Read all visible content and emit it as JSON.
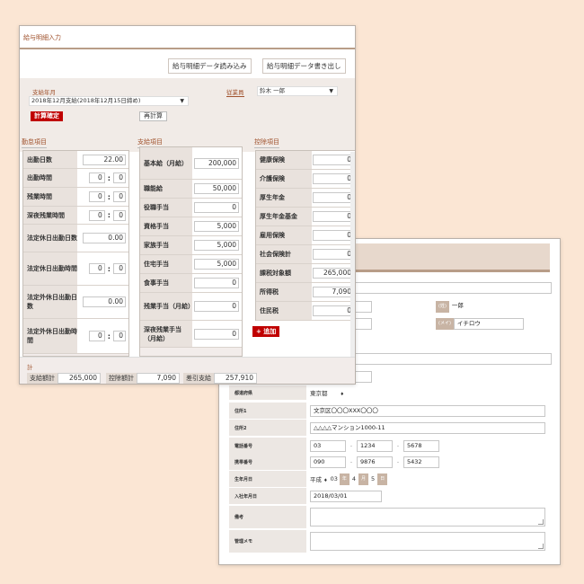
{
  "back": {
    "rows": {
      "r1_badge1": "(姓)",
      "r1_value": "一郎",
      "r2_badge": "(メイ)",
      "r2_value": "イチロウ",
      "prefecture": {
        "label": "都道府県",
        "value": "東京都"
      },
      "address1": {
        "label": "住所1",
        "value": "文京区〇〇〇XXX〇〇〇"
      },
      "address2": {
        "label": "住所2",
        "value": "△△△△マンション1000-11"
      },
      "phone": {
        "label": "電話番号",
        "p1": "03",
        "p2": "1234",
        "p3": "5678"
      },
      "mobile": {
        "label": "携帯番号",
        "p1": "090",
        "p2": "9876",
        "p3": "5432"
      },
      "birthday": {
        "label": "生年月日",
        "era": "平成",
        "year": "03",
        "year_unit": "年",
        "month": "4",
        "month_unit": "月",
        "day": "5",
        "day_unit": "日"
      },
      "joined": {
        "label": "入社年月日",
        "value": "2018/03/01"
      },
      "memo": {
        "label": "備考"
      },
      "admin_memo": {
        "label": "管理メモ"
      }
    }
  },
  "front": {
    "title": "給与明細入力",
    "buttons": {
      "load": "給与明細データ読み込み",
      "write": "給与明細データ書き出し",
      "confirm": "計算確定",
      "recalc": "再計算",
      "add": "+ 追加"
    },
    "pay_period": {
      "label": "支給年月",
      "value": "2018年12月支給(2018年12月15日締め)"
    },
    "employee": {
      "label": "従業員",
      "value": "鈴木 一郎"
    },
    "attendance": {
      "title": "勤怠項目",
      "rows": [
        {
          "label": "出勤日数",
          "value": "22.00",
          "kind": "single"
        },
        {
          "label": "出勤時間",
          "h": "0",
          "m": "0",
          "kind": "time"
        },
        {
          "label": "残業時間",
          "h": "0",
          "m": "0",
          "kind": "time"
        },
        {
          "label": "深夜残業時間",
          "h": "0",
          "m": "0",
          "kind": "time"
        },
        {
          "label": "法定休日出勤日数",
          "value": "0.00",
          "kind": "single"
        },
        {
          "label": "法定休日出勤時間",
          "h": "0",
          "m": "0",
          "kind": "time"
        },
        {
          "label": "法定外休日出勤日数",
          "value": "0.00",
          "kind": "single"
        },
        {
          "label": "法定外休日出勤時間",
          "h": "0",
          "m": "0",
          "kind": "time"
        }
      ]
    },
    "payment": {
      "title": "支給項目",
      "rows": [
        {
          "label": "基本給（月給）",
          "value": "200,000"
        },
        {
          "label": "職能給",
          "value": "50,000"
        },
        {
          "label": "役職手当",
          "value": "0"
        },
        {
          "label": "資格手当",
          "value": "5,000"
        },
        {
          "label": "家族手当",
          "value": "5,000"
        },
        {
          "label": "住宅手当",
          "value": "5,000"
        },
        {
          "label": "食事手当",
          "value": "0"
        },
        {
          "label": "残業手当（月給）",
          "value": "0"
        },
        {
          "label": "深夜残業手当（月給）",
          "value": "0"
        }
      ]
    },
    "deduction": {
      "title": "控除項目",
      "rows": [
        {
          "label": "健康保険",
          "value": "0"
        },
        {
          "label": "介護保険",
          "value": "0"
        },
        {
          "label": "厚生年金",
          "value": "0"
        },
        {
          "label": "厚生年金基金",
          "value": "0"
        },
        {
          "label": "雇用保険",
          "value": "0"
        },
        {
          "label": "社会保険計",
          "value": "0"
        },
        {
          "label": "課税対象額",
          "value": "265,000"
        },
        {
          "label": "所得税",
          "value": "7,090"
        },
        {
          "label": "住民税",
          "value": "0"
        }
      ]
    },
    "totals": {
      "title": "計",
      "pay_label": "支給額計",
      "pay_value": "265,000",
      "ded_label": "控除額計",
      "ded_value": "7,090",
      "net_label": "差引支給",
      "net_value": "257,910"
    }
  }
}
